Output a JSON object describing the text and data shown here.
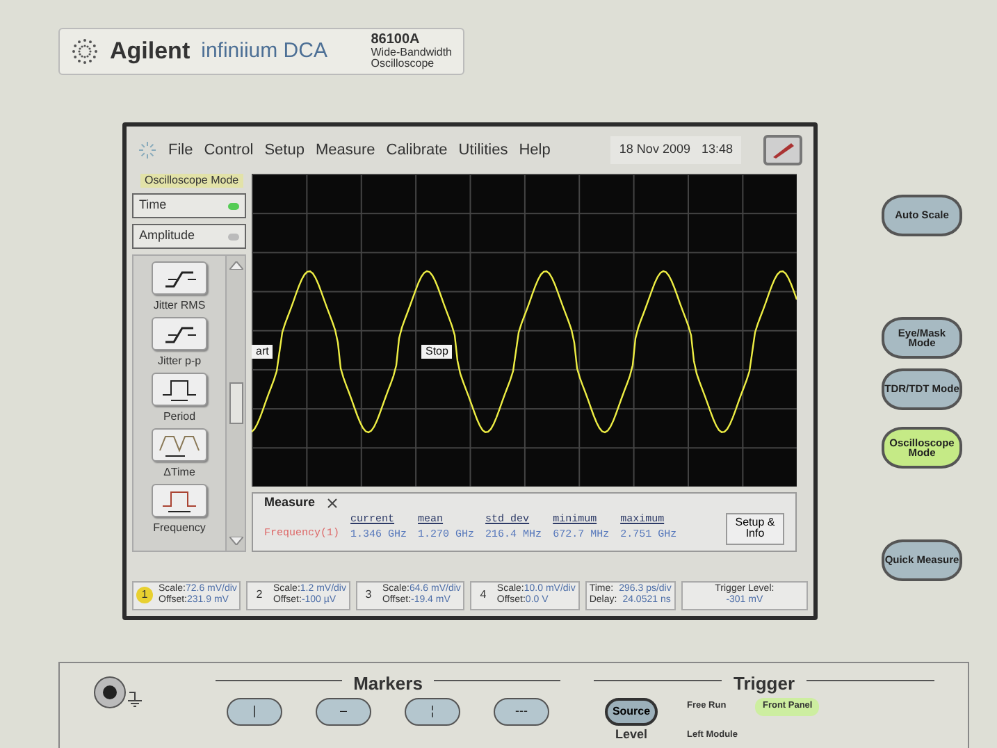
{
  "brand": {
    "name": "Agilent",
    "product": "infiniium DCA",
    "model": "86100A",
    "subtitle": [
      "Wide-Bandwidth",
      "Oscilloscope"
    ]
  },
  "menu": [
    "File",
    "Control",
    "Setup",
    "Measure",
    "Calibrate",
    "Utilities",
    "Help"
  ],
  "datetime": {
    "date": "18 Nov 2009",
    "time": "13:48"
  },
  "mode_label": "Oscilloscope Mode",
  "categories": [
    {
      "label": "Time",
      "selected": true
    },
    {
      "label": "Amplitude",
      "selected": false
    }
  ],
  "measurements": [
    {
      "label": "Jitter RMS",
      "kind": "jitter"
    },
    {
      "label": "Jitter p-p",
      "kind": "jitter"
    },
    {
      "label": "Period",
      "kind": "period"
    },
    {
      "label": "ΔTime",
      "kind": "delta"
    },
    {
      "label": "Frequency",
      "kind": "frequency"
    }
  ],
  "trace_markers": [
    {
      "label": "art"
    },
    {
      "label": "Stop"
    }
  ],
  "measure_panel": {
    "title": "Measure",
    "columns": [
      "current",
      "mean",
      "std dev",
      "minimum",
      "maximum"
    ],
    "rows": [
      {
        "name": "Frequency(1)",
        "values": [
          "1.346 GHz",
          "1.270 GHz",
          "216.4 MHz",
          "672.7 MHz",
          "2.751 GHz"
        ]
      }
    ],
    "button": "Setup & Info"
  },
  "status": {
    "channels": [
      {
        "number": "1",
        "active": true,
        "scale": {
          "label": "Scale:",
          "value": "72.6 mV/div"
        },
        "offset": {
          "label": "Offset:",
          "value": "231.9 mV"
        }
      },
      {
        "number": "2",
        "active": false,
        "scale": {
          "label": "Scale:",
          "value": "1.2 mV/div"
        },
        "offset": {
          "label": "Offset:",
          "value": "-100 µV"
        }
      },
      {
        "number": "3",
        "active": false,
        "scale": {
          "label": "Scale:",
          "value": "64.6 mV/div"
        },
        "offset": {
          "label": "Offset:",
          "value": "-19.4 mV"
        }
      },
      {
        "number": "4",
        "active": false,
        "scale": {
          "label": "Scale:",
          "value": "10.0 mV/div"
        },
        "offset": {
          "label": "Offset:",
          "value": "0.0 V"
        }
      }
    ],
    "timebase": {
      "time": {
        "label": "Time:",
        "value": "296.3 ps/div"
      },
      "delay": {
        "label": "Delay:",
        "value": "24.0521 ns"
      }
    },
    "trigger_level": {
      "label": "Trigger Level:",
      "value": "-301 mV"
    }
  },
  "front_buttons": [
    {
      "label": "Auto Scale",
      "lit": false
    },
    {
      "label": "Eye/Mask Mode",
      "lit": false
    },
    {
      "label": "TDR/TDT Mode",
      "lit": false
    },
    {
      "label": "Oscilloscope Mode",
      "lit": true
    },
    {
      "label": "Quick Measure",
      "lit": false
    }
  ],
  "markers": {
    "title": "Markers",
    "buttons": [
      "|",
      "–",
      "¦",
      "---"
    ]
  },
  "trigger": {
    "title": "Trigger",
    "source_button": "Source",
    "level_label": "Level",
    "sources": [
      {
        "label": "Free Run",
        "selected": false
      },
      {
        "label": "Left Module",
        "selected": false
      },
      {
        "label": "Front Panel",
        "selected": true
      }
    ]
  }
}
